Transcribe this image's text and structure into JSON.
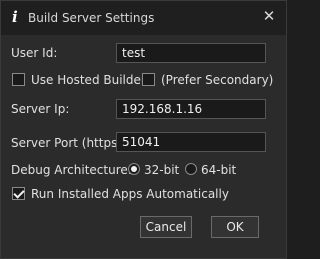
{
  "window": {
    "title": "Build Server Settings",
    "app_icon": "info-i-icon",
    "close_glyph": "✕"
  },
  "user_id": {
    "label": "User Id:",
    "value": "test"
  },
  "hosted_builder": {
    "label": "Use Hosted Builder",
    "checked": false
  },
  "prefer_secondary": {
    "label": "(Prefer Secondary)",
    "checked": false
  },
  "server_ip": {
    "label": "Server Ip:",
    "value": "192.168.1.16"
  },
  "server_port": {
    "label": "Server Port (https):",
    "value": "51041"
  },
  "debug_arch": {
    "label": "Debug Architecture:",
    "options": [
      {
        "label": "32-bit",
        "selected": true
      },
      {
        "label": "64-bit",
        "selected": false
      }
    ]
  },
  "run_installed": {
    "label": "Run Installed Apps Automatically",
    "checked": true
  },
  "buttons": {
    "cancel": "Cancel",
    "ok": "OK"
  }
}
